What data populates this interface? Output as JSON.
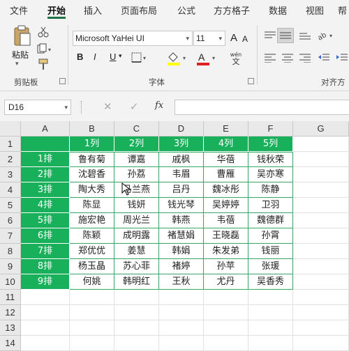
{
  "menu": {
    "tabs": [
      "文件",
      "开始",
      "插入",
      "页面布局",
      "公式",
      "方方格子",
      "数据",
      "视图",
      "帮"
    ]
  },
  "ribbon": {
    "clipboard": {
      "paste_label": "粘贴",
      "group_label": "剪贴板"
    },
    "font": {
      "font_name": "Microsoft YaHei UI",
      "font_size": "11",
      "bold": "B",
      "italic": "I",
      "underline": "U",
      "grow": "A",
      "shrink": "A",
      "wen": "wén",
      "wen2": "文",
      "group_label": "字体"
    },
    "alignment": {
      "group_label": "对齐方"
    }
  },
  "formula_bar": {
    "name_box": "D16",
    "fx": "fx",
    "formula": ""
  },
  "sheet": {
    "columns": [
      "A",
      "B",
      "C",
      "D",
      "E",
      "F",
      "G"
    ],
    "rows": [
      "1",
      "2",
      "3",
      "4",
      "5",
      "6",
      "7",
      "8",
      "9",
      "10",
      "11",
      "12",
      "13",
      "14"
    ],
    "header_row": [
      "",
      "1列",
      "2列",
      "3列",
      "4列",
      "5列"
    ],
    "data": [
      [
        "1排",
        "鲁有菊",
        "谭嘉",
        "戚枫",
        "华蓓",
        "钱秋荣"
      ],
      [
        "2排",
        "沈碧香",
        "孙荔",
        "韦眉",
        "曹雁",
        "吴亦寒"
      ],
      [
        "3排",
        "陶大秀",
        "马兰燕",
        "吕丹",
        "魏冰彤",
        "陈静"
      ],
      [
        "4排",
        "陈显",
        "钱妍",
        "钱光琴",
        "吴婷婷",
        "卫羽"
      ],
      [
        "5排",
        "施宏艳",
        "周光兰",
        "韩燕",
        "韦蓓",
        "魏德群"
      ],
      [
        "6排",
        "陈颖",
        "成明露",
        "褚慧娟",
        "王晓磊",
        "孙霄"
      ],
      [
        "7排",
        "郑优优",
        "姜慧",
        "韩娟",
        "朱发弟",
        "钱丽"
      ],
      [
        "8排",
        "杨玉晶",
        "苏心菲",
        "褚婷",
        "孙苹",
        "张瑗"
      ],
      [
        "9排",
        "何姚",
        "韩明红",
        "王秋",
        "尤丹",
        "吴香秀"
      ]
    ]
  },
  "colors": {
    "accent_green": "#217346",
    "table_green": "#18b05a",
    "grid_border": "#37a766"
  }
}
